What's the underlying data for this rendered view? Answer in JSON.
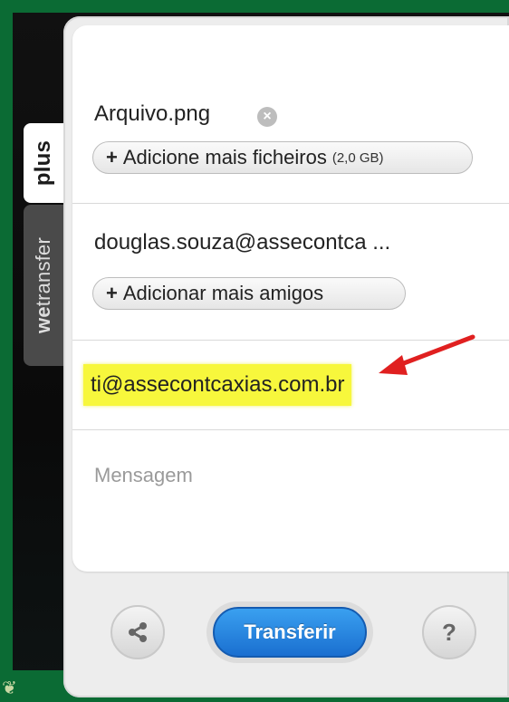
{
  "tabs": {
    "plus_label": "plus",
    "wetransfer_bold": "we",
    "wetransfer_rest": "transfer"
  },
  "files": {
    "file_name": "Arquivo.png",
    "remove_icon": "close-circle-icon",
    "add_label": "Adicione mais ficheiros",
    "size_limit": "(2,0 GB)"
  },
  "friends": {
    "email": "douglas.souza@assecontca ...",
    "add_label": "Adicionar mais amigos"
  },
  "sender": {
    "email": "ti@assecontcaxias.com.br",
    "highlight_color": "#f7f73c"
  },
  "message": {
    "placeholder": "Mensagem"
  },
  "footer": {
    "transfer_label": "Transferir",
    "help_label": "?",
    "share_icon": "share-icon"
  },
  "colors": {
    "accent_blue": "#1a6fd0",
    "arrow_red": "#e02020",
    "frame_green": "#0b6b34"
  }
}
